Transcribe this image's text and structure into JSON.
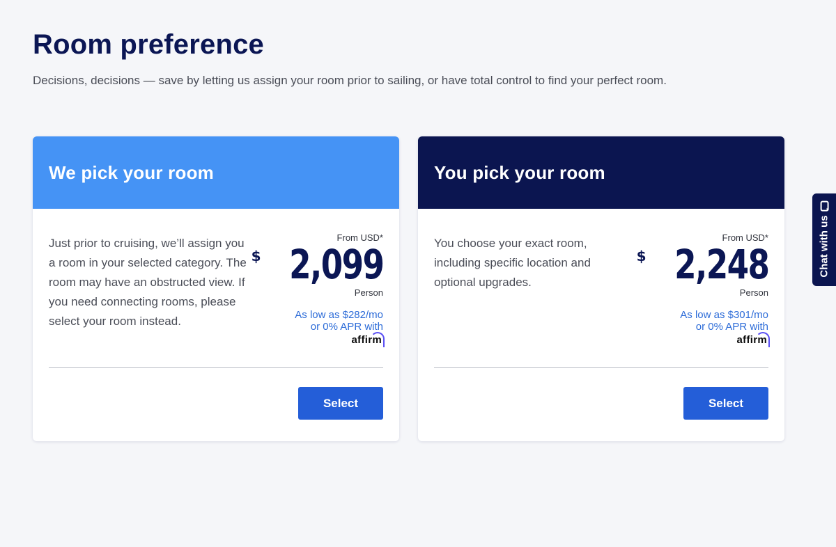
{
  "page": {
    "title": "Room preference",
    "subtitle": "Decisions, decisions — save by letting us assign your room prior to sailing, or have total control to find your perfect room."
  },
  "cards": [
    {
      "title": "We pick your room",
      "description": "Just prior to cruising, we’ll assign you a room in your selected category. The room may have an obstructed view. If you need connecting rooms, please select your room instead.",
      "price_from_label": "From USD*",
      "currency_symbol": "$",
      "price": "2,099",
      "price_unit": "Person",
      "finance_line1": "As low as $282/mo",
      "finance_line2": "or 0% APR with",
      "finance_brand": "affirm",
      "select_label": "Select",
      "header_color": "#4593f5"
    },
    {
      "title": "You pick your room",
      "description": "You choose your exact room, including specific location and optional upgrades.",
      "price_from_label": "From USD*",
      "currency_symbol": "$",
      "price": "2,248",
      "price_unit": "Person",
      "finance_line1": "As low as $301/mo",
      "finance_line2": "or 0% APR with",
      "finance_brand": "affirm",
      "select_label": "Select",
      "header_color": "#0b1550"
    }
  ],
  "chat": {
    "label": "Chat with us",
    "icon": "chat-bubble-icon"
  },
  "colors": {
    "accent_button": "#245ed8",
    "finance_link": "#2d6cd8",
    "navy": "#0b1654",
    "affirm_arc": "#5a4ff3"
  }
}
